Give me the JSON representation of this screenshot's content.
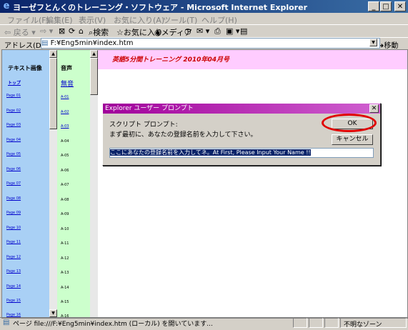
{
  "window": {
    "title": "ヨーゼフとんくのトレーニング・ソフトウェア - Microsoft Internet Explorer",
    "min_glyph": "_",
    "max_glyph": "□",
    "close_glyph": "✕"
  },
  "menu": [
    "ファイル(F)",
    "編集(E)",
    "表示(V)",
    "お気に入り(A)",
    "ツール(T)",
    "ヘルプ(H)"
  ],
  "toolbar": {
    "back": "戻る",
    "search": "検索",
    "favorites": "お気に入り",
    "media": "メディア"
  },
  "address": {
    "label": "アドレス(D)",
    "value": "F:¥Eng5min¥index.htm",
    "go": "移動"
  },
  "left_nav": {
    "header": "テキスト画像",
    "top_link": "トップ",
    "pages": [
      "Page 01",
      "Page 02",
      "Page 03",
      "Page 04",
      "Page 05",
      "Page 06",
      "Page 07",
      "Page 08",
      "Page 09",
      "Page 10",
      "Page 11",
      "Page 12",
      "Page 13",
      "Page 14",
      "Page 15",
      "Page 16"
    ]
  },
  "audio_nav": {
    "header": "音声",
    "silent_link": "無音",
    "items": [
      "A-01",
      "A-02",
      "A-03",
      "A-04",
      "A-05",
      "A-06",
      "A-07",
      "A-08",
      "A-09",
      "A-10",
      "A-11",
      "A-12",
      "A-13",
      "A-14",
      "A-15",
      "A-16"
    ]
  },
  "main": {
    "header": "英語5分間トレーニング 2010年04月号"
  },
  "dialog": {
    "title": "Explorer ユーザー プロンプト",
    "label1": "スクリプト プロンプト:",
    "label2": "まず最初に、あなたの登録名前を入力して下さい。",
    "ok": "OK",
    "cancel": "キャンセル",
    "input_value": "ここにあなたの登録名前を入力してネ。At First, Please Input Your Name !!",
    "close_glyph": "✕"
  },
  "status": {
    "text": "ページ file:///F:¥Eng5min¥index.htm (ローカル) を開いています...",
    "zone": "不明なゾーン"
  },
  "colors": {
    "titlebar": "#0a246a",
    "dialog_titlebar": "#a0009a",
    "left_nav_bg": "#a9d0f5",
    "audio_nav_bg": "#ccffcc",
    "header_bg": "#ffccff",
    "highlight_ellipse": "#e00000"
  }
}
